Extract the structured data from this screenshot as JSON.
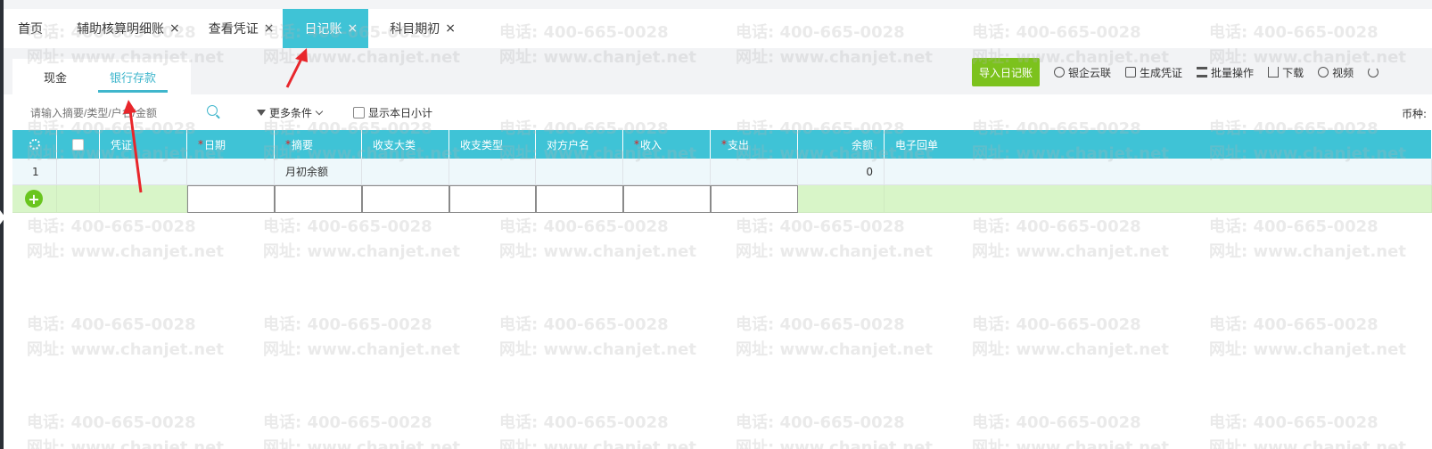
{
  "tabs": [
    {
      "label": "首页",
      "closable": false,
      "active": false
    },
    {
      "label": "辅助核算明细账",
      "closable": true,
      "active": false
    },
    {
      "label": "查看凭证",
      "closable": true,
      "active": false
    },
    {
      "label": "日记账",
      "closable": true,
      "active": true
    },
    {
      "label": "科目期初",
      "closable": true,
      "active": false
    }
  ],
  "close_glyph": "×",
  "subtabs": [
    {
      "label": "现金",
      "active": false
    },
    {
      "label": "银行存款",
      "active": true
    }
  ],
  "toolbar": {
    "import_label": "导入日记账",
    "items": [
      {
        "label": "银企云联",
        "icon": "cloud-link-icon"
      },
      {
        "label": "生成凭证",
        "icon": "voucher-icon"
      },
      {
        "label": "批量操作",
        "icon": "batch-icon"
      },
      {
        "label": "下载",
        "icon": "download-icon"
      },
      {
        "label": "视频",
        "icon": "play-icon"
      }
    ]
  },
  "filter": {
    "search_placeholder": "请输入摘要/类型/户名/金额",
    "more_label": "更多条件",
    "daily_subtotal_label": "显示本日小计",
    "currency_label": "币种:"
  },
  "table": {
    "headers": [
      {
        "label": "凭证",
        "required": false
      },
      {
        "label": "日期",
        "required": true
      },
      {
        "label": "摘要",
        "required": true
      },
      {
        "label": "收支大类",
        "required": false
      },
      {
        "label": "收支类型",
        "required": false
      },
      {
        "label": "对方户名",
        "required": false
      },
      {
        "label": "收入",
        "required": true
      },
      {
        "label": "支出",
        "required": true
      },
      {
        "label": "余额",
        "required": false
      },
      {
        "label": "电子回单",
        "required": false
      }
    ],
    "required_mark": "*",
    "rows": [
      {
        "index": "1",
        "summary": "月初余额",
        "balance": "0"
      }
    ],
    "add_glyph": "+"
  },
  "watermark": {
    "phone": "电话: 400-665-0028",
    "site": "网址: www.chanjet.net"
  },
  "colors": {
    "accent": "#3fc3d6",
    "import_button": "#7cc21d",
    "new_row": "#d8f5c8",
    "annotation_arrow": "#e8262b"
  }
}
